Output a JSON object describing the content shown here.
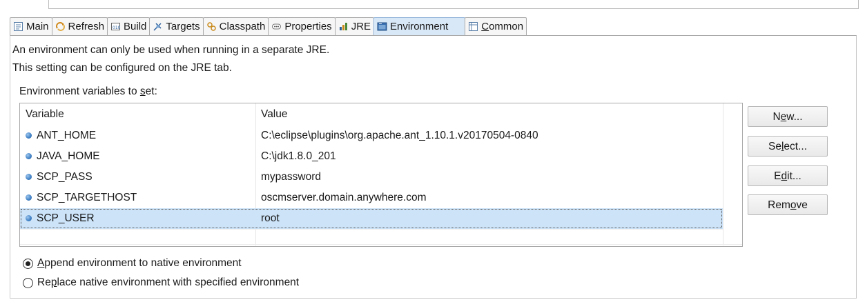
{
  "tabs": [
    {
      "id": "main",
      "label": "Main",
      "icon": "main-tab-icon",
      "active": false
    },
    {
      "id": "refresh",
      "label": "Refresh",
      "icon": "refresh-tab-icon",
      "active": false
    },
    {
      "id": "build",
      "label": "Build",
      "icon": "build-tab-icon",
      "active": false
    },
    {
      "id": "targets",
      "label": "Targets",
      "icon": "targets-tab-icon",
      "active": false
    },
    {
      "id": "classpath",
      "label": "Classpath",
      "icon": "classpath-tab-icon",
      "active": false
    },
    {
      "id": "properties",
      "label": "Properties",
      "icon": "properties-tab-icon",
      "active": false
    },
    {
      "id": "jre",
      "label": "JRE",
      "icon": "jre-tab-icon",
      "active": false
    },
    {
      "id": "environment",
      "label": "Environment",
      "icon": "environment-tab-icon",
      "active": true
    },
    {
      "id": "common",
      "label_pre": "",
      "label_mnemonic": "C",
      "label_post": "ommon",
      "icon": "common-tab-icon",
      "active": false
    }
  ],
  "info": {
    "line1": "An environment can only be used when running in a separate JRE.",
    "line2": "This setting can be configured on the JRE tab."
  },
  "env_label": {
    "pre": "Environment variables to ",
    "mnemonic": "s",
    "post": "et:"
  },
  "table": {
    "headers": {
      "variable": "Variable",
      "value": "Value"
    },
    "rows": [
      {
        "variable": "ANT_HOME",
        "value": "C:\\eclipse\\plugins\\org.apache.ant_1.10.1.v20170504-0840",
        "selected": false
      },
      {
        "variable": "JAVA_HOME",
        "value": "C:\\jdk1.8.0_201",
        "selected": false
      },
      {
        "variable": "SCP_PASS",
        "value": "mypassword",
        "selected": false
      },
      {
        "variable": "SCP_TARGETHOST",
        "value": "oscmserver.domain.anywhere.com",
        "selected": false
      },
      {
        "variable": "SCP_USER",
        "value": "root",
        "selected": true
      }
    ]
  },
  "buttons": {
    "new": {
      "pre": "N",
      "mnemonic": "e",
      "post": "w..."
    },
    "select": {
      "pre": "Se",
      "mnemonic": "l",
      "post": "ect..."
    },
    "edit": {
      "pre": "E",
      "mnemonic": "d",
      "post": "it..."
    },
    "remove": {
      "pre": "Rem",
      "mnemonic": "o",
      "post": "ve"
    }
  },
  "radios": {
    "append": {
      "pre": "",
      "mnemonic": "A",
      "post": "ppend environment to native environment",
      "checked": true
    },
    "replace": {
      "pre": "Re",
      "mnemonic": "p",
      "post": "lace native environment with specified environment",
      "checked": false
    }
  },
  "colors": {
    "active_tab": "#d9e8f7",
    "selected_row": "#cce3f8",
    "bullet": "#3f7fc4"
  }
}
